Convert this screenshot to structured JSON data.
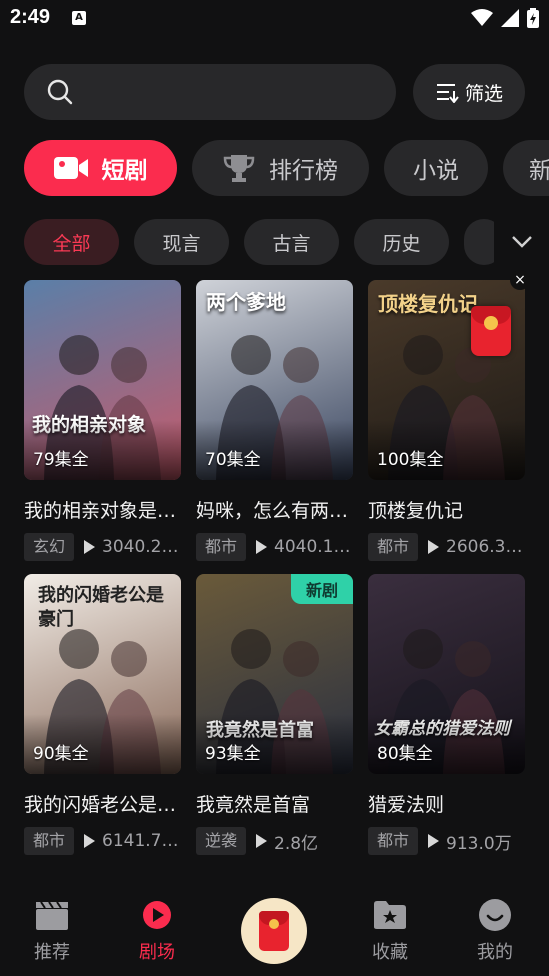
{
  "status_bar": {
    "time": "2:49",
    "notif_letter": "A"
  },
  "search": {
    "filter_label": "筛选"
  },
  "categories": [
    {
      "label": "短剧",
      "active": true
    },
    {
      "label": "排行榜",
      "active": false
    },
    {
      "label": "小说",
      "active": false
    },
    {
      "label": "新",
      "active": false
    }
  ],
  "chips": [
    {
      "label": "全部",
      "active": true
    },
    {
      "label": "现言",
      "active": false
    },
    {
      "label": "古言",
      "active": false
    },
    {
      "label": "历史",
      "active": false
    }
  ],
  "cards": [
    {
      "title": "我的相亲对象是…",
      "episodes": "79集全",
      "tag": "玄幻",
      "views": "3040.2…",
      "poster_text": "我的相亲对象",
      "colors": [
        "#5a7fa8",
        "#c85a6a"
      ]
    },
    {
      "title": "妈咪，怎么有两…",
      "episodes": "70集全",
      "tag": "都市",
      "views": "4040.1…",
      "poster_text": "两个爹地",
      "colors": [
        "#cfd2d8",
        "#3a4660"
      ]
    },
    {
      "title": "顶楼复仇记",
      "episodes": "100集全",
      "tag": "都市",
      "views": "2606.3…",
      "poster_text": "顶楼复仇记",
      "colors": [
        "#4a3a2a",
        "#1e1a16"
      ]
    },
    {
      "title": "我的闪婚老公是…",
      "episodes": "90集全",
      "tag": "都市",
      "views": "6141.7…",
      "poster_text": "我的闪婚老公是豪门",
      "colors": [
        "#f1ece6",
        "#8a6a5a"
      ]
    },
    {
      "title": "我竟然是首富",
      "episodes": "93集全",
      "tag": "逆袭",
      "views": "2.8亿",
      "poster_text": "我竟然是首富",
      "colors": [
        "#6a5a3a",
        "#2a3040"
      ],
      "badge": "新剧"
    },
    {
      "title": "猎爱法则",
      "episodes": "80集全",
      "tag": "都市",
      "views": "913.0万",
      "poster_text": "女霸总的猎爱法则",
      "colors": [
        "#3a2e3e",
        "#15121a"
      ]
    }
  ],
  "float": {
    "close": "×"
  },
  "bottom_nav": [
    {
      "label": "推荐",
      "icon": "clapper-icon",
      "active": false
    },
    {
      "label": "剧场",
      "icon": "play-circle-icon",
      "active": true
    },
    {
      "label": "收藏",
      "icon": "folder-star-icon",
      "active": false
    },
    {
      "label": "我的",
      "icon": "smile-icon",
      "active": false
    }
  ],
  "colors": {
    "accent": "#fb2c4e",
    "background": "#111112",
    "surface": "#28282a",
    "new_badge": "#2fd1a8"
  }
}
